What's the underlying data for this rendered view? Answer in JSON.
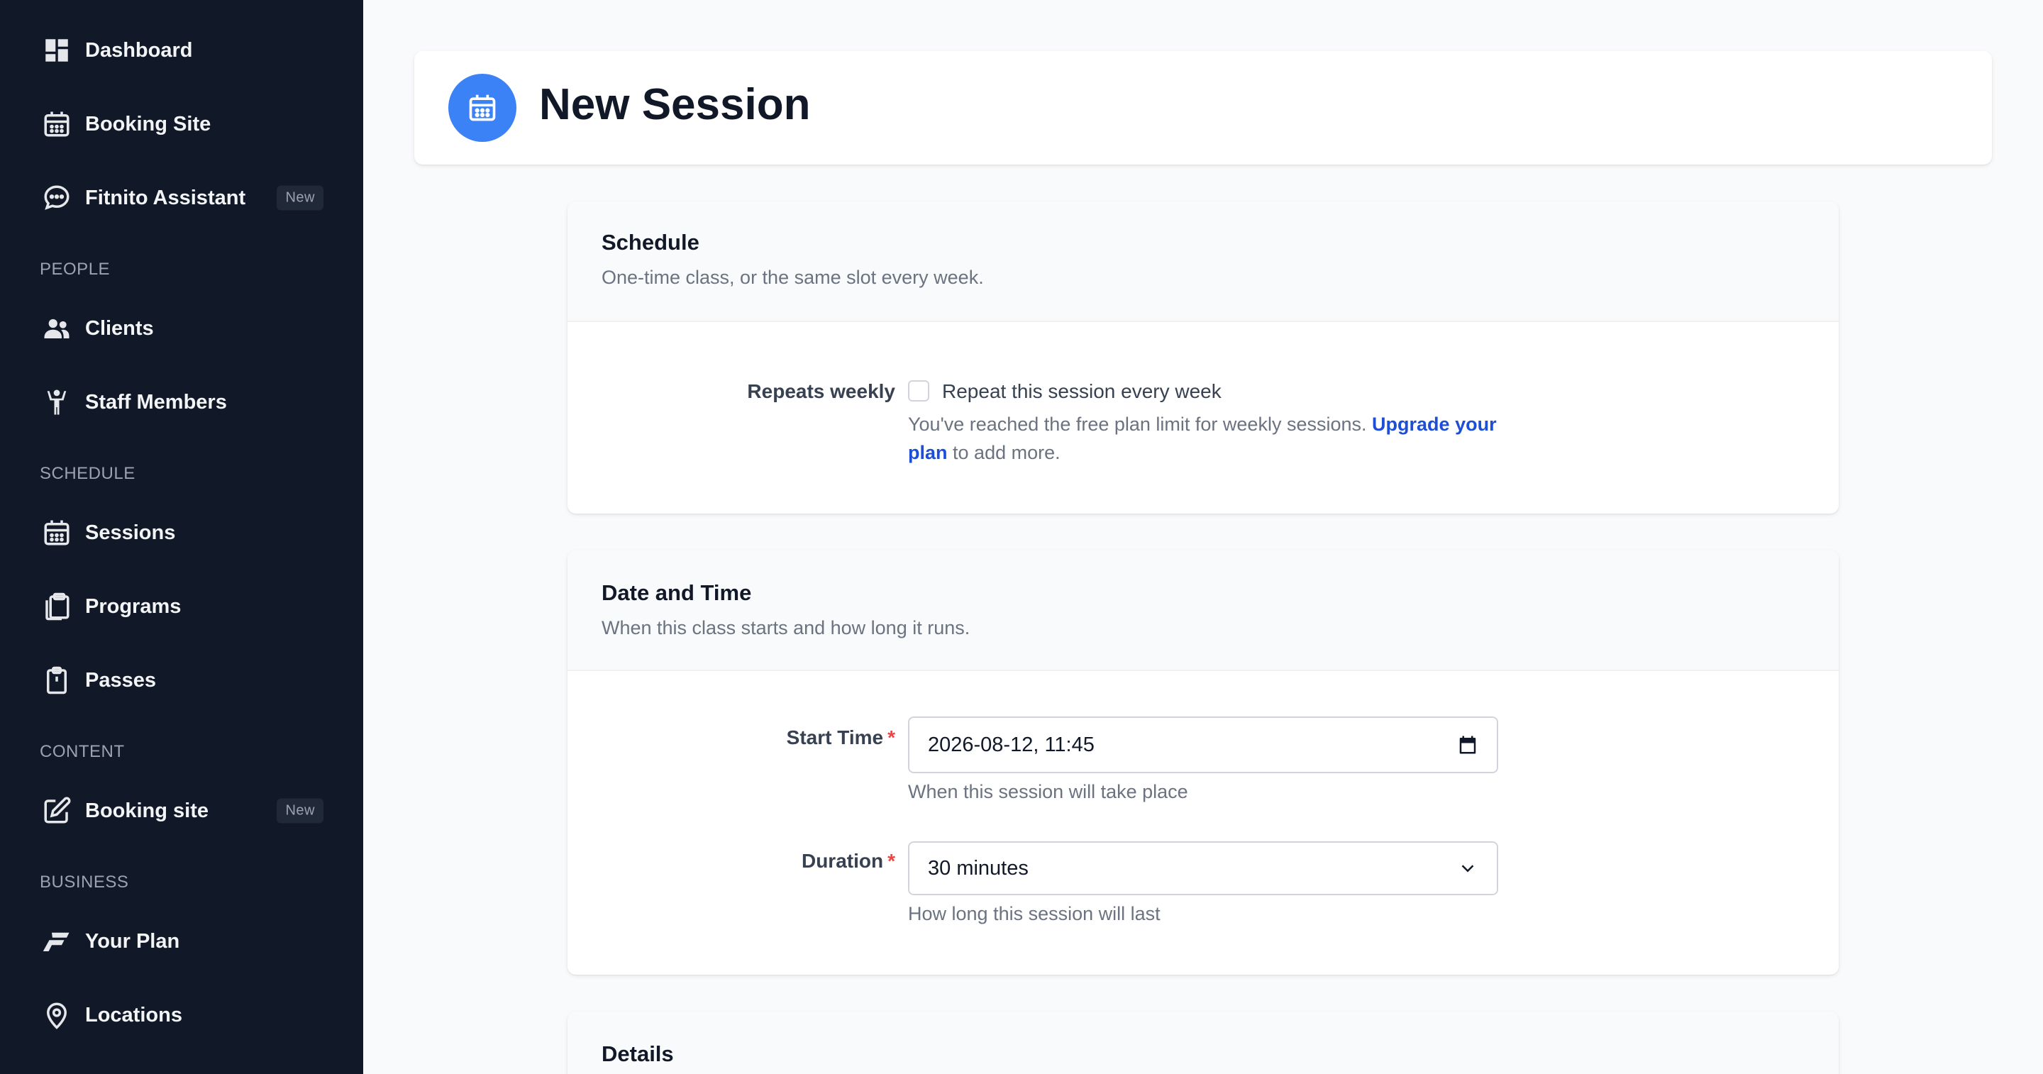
{
  "sidebar": {
    "items": [
      {
        "label": "Dashboard",
        "icon": "dashboard-icon"
      },
      {
        "label": "Booking Site",
        "icon": "calendar-icon"
      },
      {
        "label": "Fitnito Assistant",
        "icon": "chat-icon",
        "badge": "New"
      },
      {
        "label": "Clients",
        "icon": "users-icon"
      },
      {
        "label": "Staff Members",
        "icon": "person-icon"
      },
      {
        "label": "Sessions",
        "icon": "calendar-icon"
      },
      {
        "label": "Programs",
        "icon": "clipboard-stack-icon"
      },
      {
        "label": "Passes",
        "icon": "clipboard-icon"
      },
      {
        "label": "Booking site",
        "icon": "edit-icon",
        "badge": "New"
      },
      {
        "label": "Your Plan",
        "icon": "brand-f-icon"
      },
      {
        "label": "Locations",
        "icon": "map-pin-icon"
      }
    ],
    "sections": [
      "PEOPLE",
      "SCHEDULE",
      "CONTENT",
      "BUSINESS"
    ]
  },
  "header": {
    "title": "New Session"
  },
  "schedule": {
    "title": "Schedule",
    "description": "One-time class, or the same slot every week.",
    "repeats_label": "Repeats weekly",
    "checkbox_label": "Repeat this session every week",
    "checked": false,
    "limit_text": "You've reached the free plan limit for weekly sessions.",
    "upgrade_link_1": "Upgrade",
    "upgrade_link_2": "your plan",
    "limit_tail": "to add more."
  },
  "datetime": {
    "title": "Date and Time",
    "description": "When this class starts and how long it runs.",
    "start_label": "Start Time",
    "start_value": "2026-08-12, 11:45",
    "start_help": "When this session will take place",
    "duration_label": "Duration",
    "duration_value": "30 minutes",
    "duration_help": "How long this session will last",
    "required_mark": "*"
  },
  "details": {
    "title": "Details"
  },
  "colors": {
    "sidebar_bg": "#111827",
    "accent": "#3b82f6",
    "link": "#1d4ed8",
    "required": "#ef4444"
  }
}
